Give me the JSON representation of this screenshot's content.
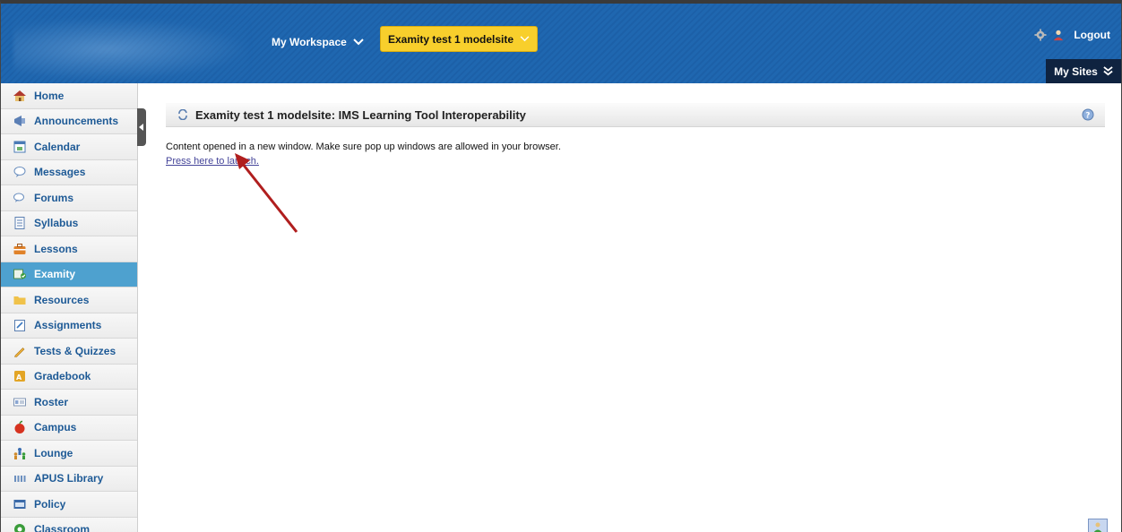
{
  "header": {
    "workspace_label": "My Workspace",
    "site_label": "Examity test 1 modelsite",
    "logout_label": "Logout",
    "my_sites_label": "My Sites"
  },
  "sidebar": {
    "items": [
      {
        "label": "Home",
        "icon": "home-icon"
      },
      {
        "label": "Announcements",
        "icon": "megaphone-icon"
      },
      {
        "label": "Calendar",
        "icon": "calendar-icon"
      },
      {
        "label": "Messages",
        "icon": "speech-bubble-icon"
      },
      {
        "label": "Forums",
        "icon": "forum-bubbles-icon"
      },
      {
        "label": "Syllabus",
        "icon": "document-icon"
      },
      {
        "label": "Lessons",
        "icon": "briefcase-icon"
      },
      {
        "label": "Examity",
        "icon": "puzzle-icon",
        "active": true
      },
      {
        "label": "Resources",
        "icon": "folder-icon"
      },
      {
        "label": "Assignments",
        "icon": "clipboard-icon"
      },
      {
        "label": "Tests & Quizzes",
        "icon": "pencil-icon"
      },
      {
        "label": "Gradebook",
        "icon": "gradebook-icon"
      },
      {
        "label": "Roster",
        "icon": "id-card-icon"
      },
      {
        "label": "Campus",
        "icon": "apple-icon"
      },
      {
        "label": "Lounge",
        "icon": "people-icon"
      },
      {
        "label": "APUS Library",
        "icon": "library-icon"
      },
      {
        "label": "Policy",
        "icon": "policy-icon"
      },
      {
        "label": "Classroom",
        "icon": "classroom-icon"
      }
    ]
  },
  "main": {
    "title": "Examity test 1 modelsite: IMS Learning Tool Interoperability",
    "message": "Content opened in a new window. Make sure pop up windows are allowed in your browser.",
    "launch_link": "Press here to launch."
  },
  "colors": {
    "header_blue": "#1f67b0",
    "site_tab_yellow": "#f8cf2c",
    "active_nav": "#4ea1cf",
    "nav_text": "#1e5a96",
    "arrow_red": "#b01e1e"
  }
}
